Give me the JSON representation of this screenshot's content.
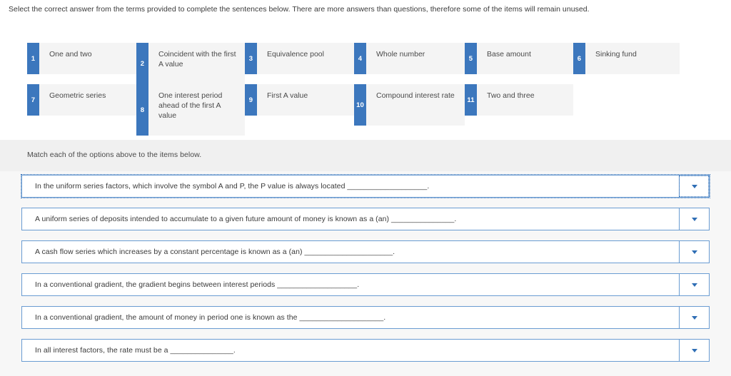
{
  "page": {
    "instruction": "Select the correct answer from the terms provided to complete the sentences below. There are more answers than questions, therefore some of the items will remain unused.",
    "match_instruction": "Match each of the options above to the items below.",
    "accent_color": "#3c77bd",
    "tile_background": "#f4f4f4",
    "band_background": "#f0f0f0",
    "row_border_color": "#6a9cd2"
  },
  "terms": [
    {
      "number": "1",
      "label": "One and two"
    },
    {
      "number": "2",
      "label": "Coincident with the first A value"
    },
    {
      "number": "3",
      "label": "Equivalence pool"
    },
    {
      "number": "4",
      "label": "Whole number"
    },
    {
      "number": "5",
      "label": "Base amount"
    },
    {
      "number": "6",
      "label": "Sinking fund"
    },
    {
      "number": "7",
      "label": "Geometric series"
    },
    {
      "number": "8",
      "label": "One interest period ahead of the first A value"
    },
    {
      "number": "9",
      "label": "First A value"
    },
    {
      "number": "10",
      "label": "Compound interest rate"
    },
    {
      "number": "11",
      "label": "Two and three"
    }
  ],
  "questions": [
    {
      "text": "In the uniform series factors, which involve the symbol A and P, the P value is always located ___________________.",
      "selected": "",
      "dropdown_icon": "chevron-down-icon",
      "focused": true
    },
    {
      "text": "A uniform series of deposits intended to accumulate to a given future amount of money is known as a (an) _______________.",
      "selected": "",
      "dropdown_icon": "chevron-down-icon",
      "focused": false
    },
    {
      "text": "A cash flow series which increases by a constant percentage is known as a (an) _____________________.",
      "selected": "",
      "dropdown_icon": "chevron-down-icon",
      "focused": false
    },
    {
      "text": "In a conventional gradient, the gradient begins between interest periods ___________________.",
      "selected": "",
      "dropdown_icon": "chevron-down-icon",
      "focused": false
    },
    {
      "text": "In a conventional gradient, the amount of money in period one is known as the ____________________.",
      "selected": "",
      "dropdown_icon": "chevron-down-icon",
      "focused": false
    },
    {
      "text": "In all interest factors, the rate must be a _______________.",
      "selected": "",
      "dropdown_icon": "chevron-down-icon",
      "focused": false
    }
  ]
}
